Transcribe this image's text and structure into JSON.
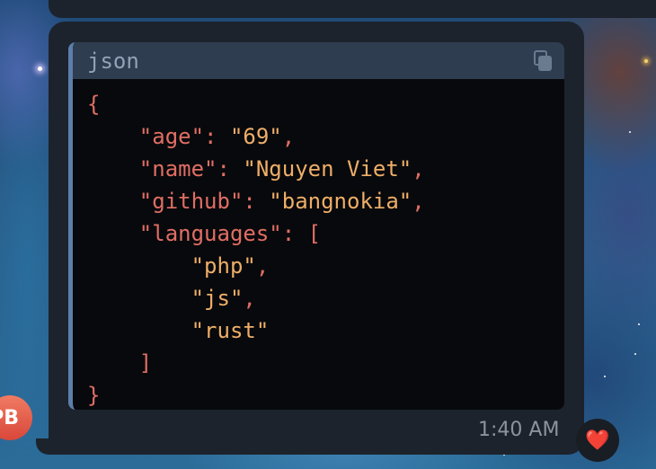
{
  "message": {
    "avatar_initials": "PB",
    "code_block": {
      "language": "json",
      "lines": [
        [
          {
            "t": "punct",
            "v": "{"
          }
        ],
        [
          {
            "t": "pad",
            "v": "    "
          },
          {
            "t": "key",
            "v": "\"age\""
          },
          {
            "t": "punct",
            "v": ": "
          },
          {
            "t": "str",
            "v": "\"69\""
          },
          {
            "t": "punct",
            "v": ","
          }
        ],
        [
          {
            "t": "pad",
            "v": "    "
          },
          {
            "t": "key",
            "v": "\"name\""
          },
          {
            "t": "punct",
            "v": ": "
          },
          {
            "t": "str",
            "v": "\"Nguyen Viet\""
          },
          {
            "t": "punct",
            "v": ","
          }
        ],
        [
          {
            "t": "pad",
            "v": "    "
          },
          {
            "t": "key",
            "v": "\"github\""
          },
          {
            "t": "punct",
            "v": ": "
          },
          {
            "t": "str",
            "v": "\"bangnokia\""
          },
          {
            "t": "punct",
            "v": ","
          }
        ],
        [
          {
            "t": "pad",
            "v": "    "
          },
          {
            "t": "key",
            "v": "\"languages\""
          },
          {
            "t": "punct",
            "v": ": ["
          }
        ],
        [
          {
            "t": "pad",
            "v": "        "
          },
          {
            "t": "str",
            "v": "\"php\""
          },
          {
            "t": "punct",
            "v": ","
          }
        ],
        [
          {
            "t": "pad",
            "v": "        "
          },
          {
            "t": "str",
            "v": "\"js\""
          },
          {
            "t": "punct",
            "v": ","
          }
        ],
        [
          {
            "t": "pad",
            "v": "        "
          },
          {
            "t": "str",
            "v": "\"rust\""
          }
        ],
        [
          {
            "t": "pad",
            "v": "    "
          },
          {
            "t": "punct",
            "v": "]"
          }
        ],
        [
          {
            "t": "punct",
            "v": "}"
          }
        ]
      ]
    },
    "time": "1:40 AM",
    "reaction": "❤️"
  },
  "icons": {
    "copy": "copy-icon",
    "reaction": "heart-icon"
  },
  "colors": {
    "bubble": "#1c232c",
    "code_header": "#2e3d50",
    "code_bg": "#08090c",
    "code_accent": "#5c7ea9",
    "token_punct_key": "#e06e64",
    "token_string": "#eeae68",
    "time_text": "#8b949e",
    "avatar": "#e35d4b"
  }
}
